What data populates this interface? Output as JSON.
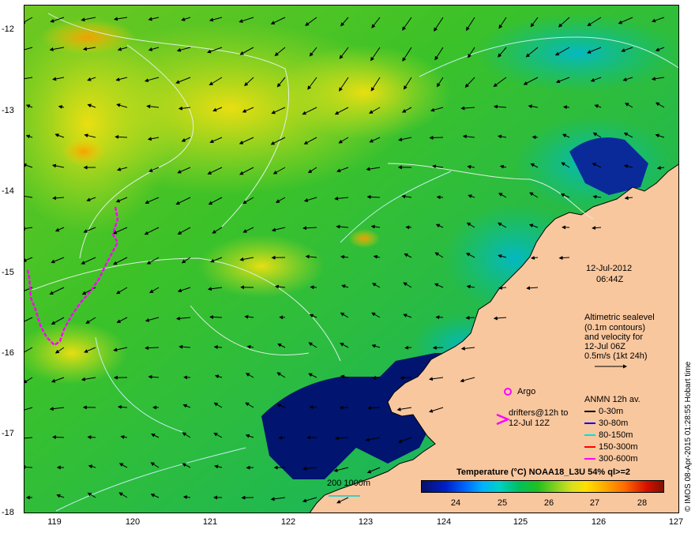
{
  "map": {
    "lat_ticks": [
      "-12",
      "-13",
      "-14",
      "-15",
      "-16",
      "-17",
      "-18"
    ],
    "lon_ticks": [
      "119",
      "120",
      "121",
      "122",
      "123",
      "124",
      "125",
      "126",
      "127"
    ],
    "lon_range": [
      118.6,
      127.0
    ],
    "lat_range": [
      -11.8,
      -18.0
    ]
  },
  "info": {
    "date": "12-Jul-2012",
    "time": "06:44Z",
    "alt_line1": "Altimetric sealevel",
    "alt_line2": "(0.1m contours)",
    "alt_line3": "and velocity for",
    "alt_line4": "12-Jul 06Z",
    "alt_line5": "0.5m/s (1kt 24h)"
  },
  "legend": {
    "argo": "Argo",
    "drifters_line1": "drifters@12h to",
    "drifters_line2": "12-Jul 12Z",
    "anmn_title": "ANMN 12h av.",
    "depths": [
      {
        "label": "0-30m",
        "color": "#000000"
      },
      {
        "label": "30-80m",
        "color": "#0000ff"
      },
      {
        "label": "80-150m",
        "color": "#00e0e0"
      },
      {
        "label": "150-300m",
        "color": "#ff0000"
      },
      {
        "label": "300-600m",
        "color": "#ff00ff"
      }
    ],
    "bathymetry": "200  1000m"
  },
  "colorbar": {
    "title": "Temperature (°C) NOAA18_L3U 54% ql>=2",
    "labels": [
      "24",
      "25",
      "26",
      "27",
      "28"
    ]
  },
  "credit": "© IMOS 08-Apr-2015 01:28:55 Hobart time",
  "colors": {
    "land": "#f9c79e",
    "ocean_mid": "#21c021",
    "ocean_warm": "#e0e020",
    "ocean_cool": "#00c0c0",
    "ocean_cold": "#001080",
    "drifter": "#ff00ff"
  }
}
